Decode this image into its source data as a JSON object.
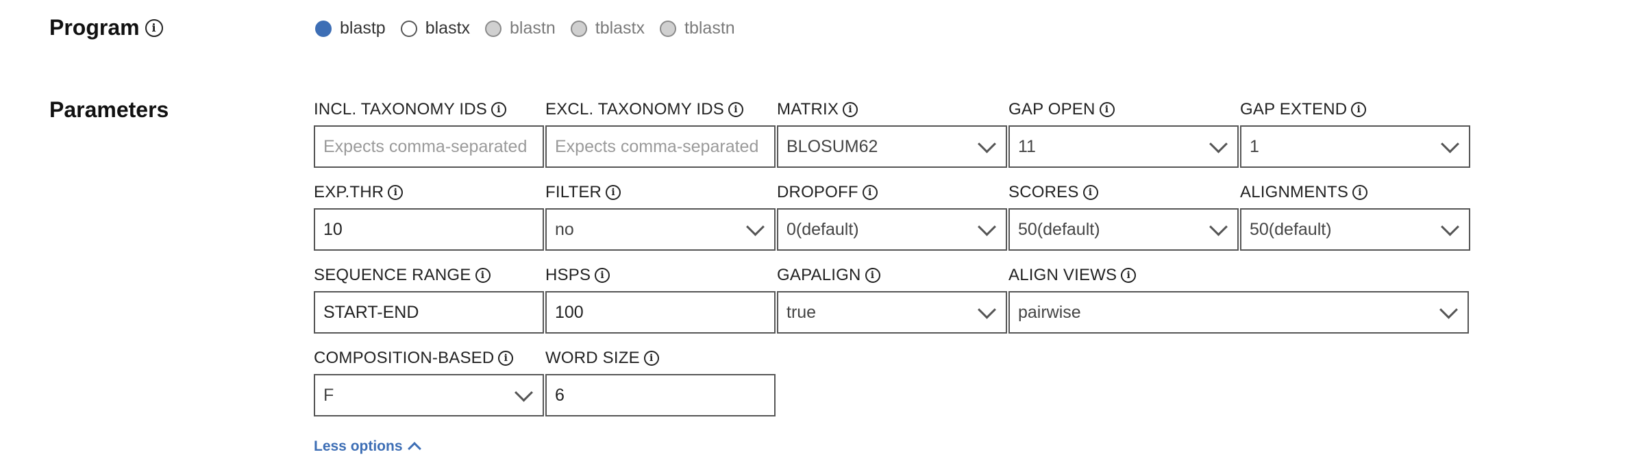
{
  "program": {
    "title": "Program",
    "options": [
      {
        "label": "blastp",
        "state": "selected"
      },
      {
        "label": "blastx",
        "state": "enabled"
      },
      {
        "label": "blastn",
        "state": "disabled"
      },
      {
        "label": "tblastx",
        "state": "disabled"
      },
      {
        "label": "tblastn",
        "state": "disabled"
      }
    ]
  },
  "parameters": {
    "title": "Parameters",
    "fields": {
      "incl_taxonomy": {
        "label": "INCL. TAXONOMY IDS",
        "placeholder": "Expects comma-separated"
      },
      "excl_taxonomy": {
        "label": "EXCL. TAXONOMY IDS",
        "placeholder": "Expects comma-separated"
      },
      "matrix": {
        "label": "MATRIX",
        "value": "BLOSUM62"
      },
      "gap_open": {
        "label": "GAP OPEN",
        "value": "11"
      },
      "gap_extend": {
        "label": "GAP EXTEND",
        "value": "1"
      },
      "exp_thr": {
        "label": "EXP.THR",
        "value": "10"
      },
      "filter": {
        "label": "FILTER",
        "value": "no"
      },
      "dropoff": {
        "label": "DROPOFF",
        "value": "0(default)"
      },
      "scores": {
        "label": "SCORES",
        "value": "50(default)"
      },
      "alignments": {
        "label": "ALIGNMENTS",
        "value": "50(default)"
      },
      "sequence_range": {
        "label": "SEQUENCE RANGE",
        "value": "START-END"
      },
      "hsps": {
        "label": "HSPS",
        "value": "100"
      },
      "gapalign": {
        "label": "GAPALIGN",
        "value": "true"
      },
      "align_views": {
        "label": "ALIGN VIEWS",
        "value": "pairwise"
      },
      "composition_based": {
        "label": "COMPOSITION-BASED",
        "value": "F"
      },
      "word_size": {
        "label": "WORD SIZE",
        "value": "6"
      }
    },
    "less_options": "Less options"
  },
  "colors": {
    "accent": "#3d6eb5",
    "border": "#555555"
  },
  "icons": {
    "info": "info-icon",
    "select": "chevron-down-icon",
    "collapse": "chevron-up-icon"
  }
}
